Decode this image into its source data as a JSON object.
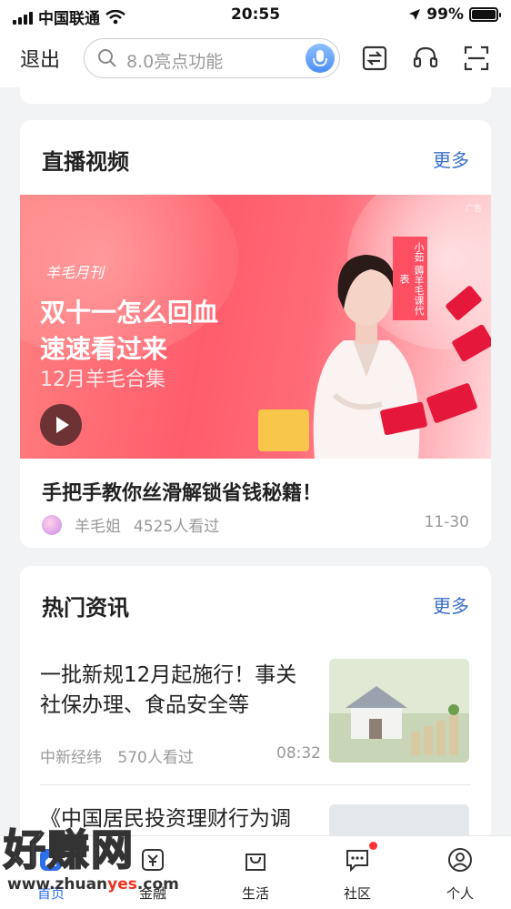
{
  "status_bar": {
    "carrier": "中国联通",
    "time": "20:55",
    "battery": "99%",
    "battery_level": 0.99
  },
  "header": {
    "exit_label": "退出",
    "search_placeholder": "8.0亮点功能"
  },
  "live_video": {
    "title": "直播视频",
    "more_label": "更多",
    "banner": {
      "brand": "羊毛月刊",
      "headline": "双十一怎么回血\n速速看过来",
      "subtitle": "12月羊毛合集",
      "ad_tag": "广告",
      "vertical_tag": "小茹 薅羊毛课代表"
    },
    "video_title": "手把手教你丝滑解锁省钱秘籍！",
    "author": "羊毛姐",
    "views": "4525人看过",
    "date": "11-30"
  },
  "hot_news": {
    "title": "热门资讯",
    "more_label": "更多",
    "items": [
      {
        "title": "一批新规12月起施行！事关社保办理、食品安全等",
        "source": "中新经纬",
        "views": "570人看过",
        "time": "08:32"
      },
      {
        "title": "《中国居民投资理财行为调"
      }
    ]
  },
  "tabbar": {
    "items": [
      {
        "label": "首页",
        "icon": "home-icon",
        "active": true
      },
      {
        "label": "金融",
        "icon": "finance-icon"
      },
      {
        "label": "生活",
        "icon": "shopping-bag-icon"
      },
      {
        "label": "社区",
        "icon": "chat-bubble-icon"
      },
      {
        "label": "个人",
        "icon": "person-icon"
      }
    ]
  },
  "watermark": {
    "text": "好赚网",
    "url_prefix": "www.zhuan",
    "url_highlight": "yes",
    "url_suffix": ".com"
  },
  "colors": {
    "accent_blue": "#3a6fc9",
    "banner_red": "#ff5d6b",
    "notify_red": "#ff3333"
  }
}
